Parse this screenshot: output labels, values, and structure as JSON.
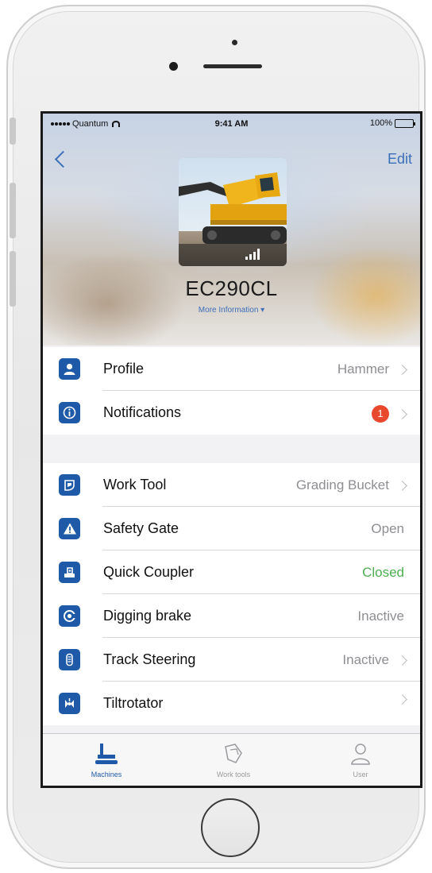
{
  "status_bar": {
    "carrier": "Quantum",
    "time": "9:41 AM",
    "battery": "100%"
  },
  "nav": {
    "edit_label": "Edit"
  },
  "machine": {
    "name": "EC290CL",
    "more_info": "More Information ▾"
  },
  "group1": [
    {
      "label": "Profile",
      "value": "Hammer",
      "chevron": true,
      "icon": "user-icon"
    },
    {
      "label": "Notifications",
      "badge": "1",
      "chevron": true,
      "icon": "info-icon"
    }
  ],
  "group2": [
    {
      "label": "Work Tool",
      "value": "Grading Bucket",
      "chevron": true,
      "icon": "bucket-icon"
    },
    {
      "label": "Safety Gate",
      "value": "Open",
      "chevron": false,
      "icon": "warning-icon"
    },
    {
      "label": "Quick Coupler",
      "value": "Closed",
      "chevron": false,
      "icon": "coupler-icon"
    },
    {
      "label": "Digging brake",
      "value": "Inactive",
      "chevron": false,
      "icon": "brake-icon"
    },
    {
      "label": "Track Steering",
      "value": "Inactive",
      "chevron": true,
      "icon": "track-icon"
    },
    {
      "label": "Tiltrotator",
      "value": "",
      "chevron": true,
      "icon": "tiltrotator-icon"
    }
  ],
  "tabs": [
    {
      "label": "Machines",
      "icon": "excavator-icon",
      "active": true
    },
    {
      "label": "Work tools",
      "icon": "work-tool-icon",
      "active": false
    },
    {
      "label": "User",
      "icon": "user-outline-icon",
      "active": false
    }
  ],
  "colors": {
    "accent": "#3d6fb6",
    "icon_tile": "#1e5aa8",
    "badge": "#e8482b",
    "closed_green": "#4caf50",
    "secondary_text": "#8e8e93"
  }
}
